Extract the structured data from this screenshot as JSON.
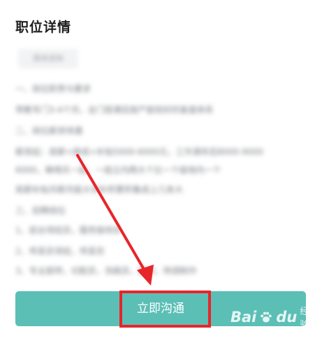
{
  "page": {
    "title": "职位详情"
  },
  "content": {
    "tag": "周末双休",
    "lines": [
      "一、岗位职责与要求",
      "带教专门3-4个月，全门授课后按产能较好的复盘体系",
      "二、岗位薪资待遇",
      "薪资起：底薪+提成+补贴5000-6000元，工作满年后8000-9000",
      "6000，嘛嗝天一起，一组立内两大个比一个级地内一个",
      "底薪补贴月薪月能大学补积累积集成上几条大",
      "三、招聘岗位",
      "1、前台领班员，服务接待员",
      "2、传菜员领班，传菜员",
      "3、专业厨师，切配员，洗碗员，面点，特调制作"
    ]
  },
  "footer": {
    "cta_label": "立即沟通"
  },
  "annotation": {
    "color": "#e8252a"
  },
  "watermark": {
    "brand": "Bai",
    "brand2": "du",
    "suffix": "经验"
  },
  "colors": {
    "cta": "#5bbfb6",
    "title": "#1e1e1e"
  }
}
